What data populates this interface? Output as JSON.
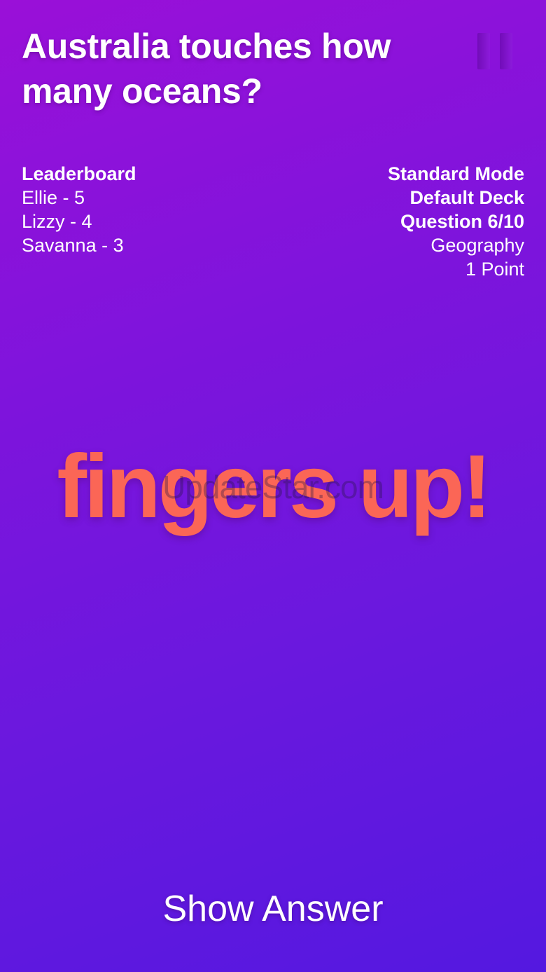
{
  "question": "Australia touches how many oceans?",
  "pause_icon": "pause-icon",
  "leaderboard": {
    "title": "Leaderboard",
    "entries": [
      "Ellie - 5",
      "Lizzy - 4",
      "Savanna - 3"
    ]
  },
  "game_info": {
    "mode": "Standard Mode",
    "deck": "Default Deck",
    "question_progress": "Question 6/10",
    "category": "Geography",
    "points": "1 Point"
  },
  "prompt": "fingers up!",
  "watermark": "UpdateStar.com",
  "show_answer_label": "Show Answer",
  "colors": {
    "background_top": "#9a10d8",
    "background_bottom": "#5418e0",
    "prompt": "#fb6656",
    "text": "#ffffff"
  }
}
